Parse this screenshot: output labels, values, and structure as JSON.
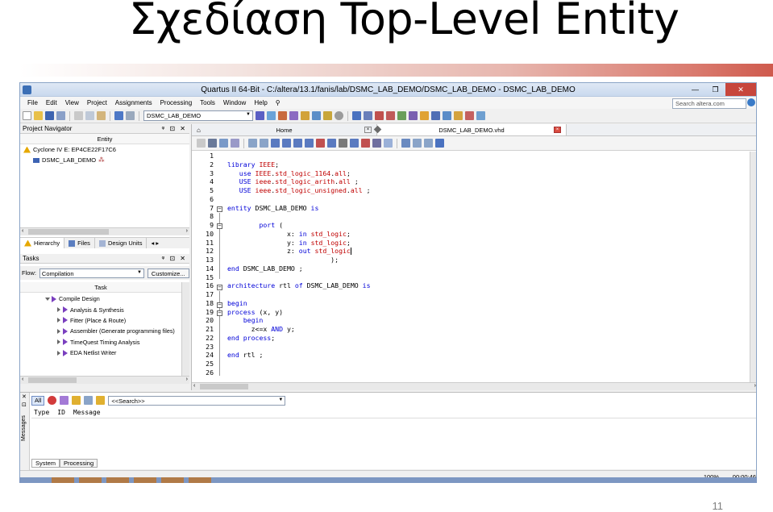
{
  "slide": {
    "title": "Σχεδίαση Top-Level Entity",
    "page_number": "11"
  },
  "window": {
    "title": "Quartus II 64-Bit - C:/altera/13.1/fanis/lab/DSMC_LAB_DEMO/DSMC_LAB_DEMO - DSMC_LAB_DEMO",
    "controls": {
      "minimize": "—",
      "maximize": "❐",
      "close": "✕"
    }
  },
  "menu": {
    "items": [
      "File",
      "Edit",
      "View",
      "Project",
      "Assignments",
      "Processing",
      "Tools",
      "Window",
      "Help"
    ],
    "search_placeholder": "Search altera.com"
  },
  "toolbar": {
    "project_combo": "DSMC_LAB_DEMO"
  },
  "project_navigator": {
    "title": "Project Navigator",
    "pane_controls": "ᵠ ⊡ ✕",
    "column": "Entity",
    "device": "Cyclone IV E: EP4CE22F17C6",
    "top_entity": "DSMC_LAB_DEMO",
    "tabs": [
      "Hierarchy",
      "Files",
      "Design Units"
    ]
  },
  "tasks": {
    "title": "Tasks",
    "pane_controls": "ᵠ ⊡ ✕",
    "flow_label": "Flow:",
    "flow_value": "Compilation",
    "customize_label": "Customize...",
    "column": "Task",
    "items": [
      "Compile Design",
      "Analysis & Synthesis",
      "Fitter (Place & Route)",
      "Assembler (Generate programming files)",
      "TimeQuest Timing Analysis",
      "EDA Netlist Writer"
    ]
  },
  "editor": {
    "tabs": [
      {
        "label": "Home"
      },
      {
        "label": "DSMC_LAB_DEMO.vhd"
      }
    ],
    "lines": [
      "",
      "library IEEE;",
      "   use IEEE.std_logic_1164.all;",
      "   USE ieee.std_logic_arith.all ;",
      "   USE ieee.std_logic_unsigned.all ;",
      "",
      "entity DSMC_LAB_DEMO is",
      "",
      "        port (",
      "               x: in std_logic;",
      "               y: in std_logic;",
      "               z: out std_logic",
      "                          );",
      "end DSMC_LAB_DEMO ;",
      "",
      "architecture rtl of DSMC_LAB_DEMO is",
      "",
      "begin",
      "process (x, y)",
      "    begin",
      "      z<=x AND y;",
      "end process;",
      "",
      "end rtl ;",
      "",
      ""
    ]
  },
  "messages": {
    "side_label": "Messages",
    "all_button": "All",
    "search_placeholder": "<<Search>>",
    "columns": [
      "Type",
      "ID",
      "Message"
    ],
    "tabs": [
      "System",
      "Processing"
    ]
  },
  "status": {
    "zoom": "100%",
    "time": "00:00:46"
  },
  "colors": {
    "keyword": "#0000d8",
    "type": "#c00000",
    "close_button": "#c7463c"
  }
}
